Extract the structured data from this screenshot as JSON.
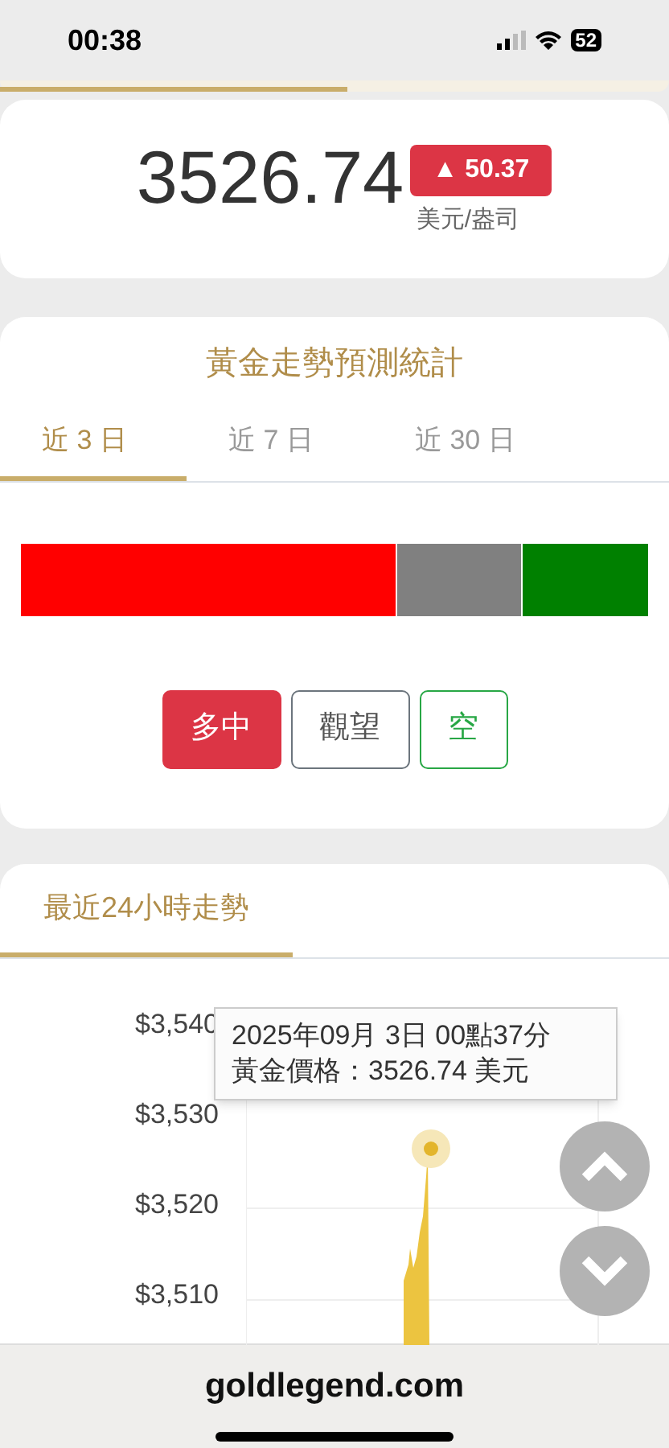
{
  "status_bar": {
    "time": "00:38",
    "battery": "52"
  },
  "top_progress": {
    "level": 0.52
  },
  "price": {
    "value": "3526.74",
    "change": "▲ 50.37",
    "unit": "美元/盎司"
  },
  "forecast": {
    "title": "黃金走勢預測統計",
    "tabs": [
      {
        "label": "近 3 日",
        "selected": true
      },
      {
        "label": "近 7 日",
        "selected": false
      },
      {
        "label": "近 30 日",
        "selected": false
      }
    ],
    "segments": [
      {
        "color": "#ff0000"
      },
      {
        "color": "#808080"
      },
      {
        "color": "#008000"
      }
    ],
    "buttons": [
      {
        "label": "多中",
        "kind": "bull",
        "selected": true
      },
      {
        "label": "觀望",
        "kind": "neutral",
        "selected": false
      },
      {
        "label": "空",
        "kind": "bear",
        "selected": false
      }
    ]
  },
  "trend": {
    "tabs": [
      {
        "label": "最近24小時走勢",
        "selected": true
      }
    ],
    "yticks": [
      "$3,540",
      "$3,530",
      "$3,520",
      "$3,510"
    ],
    "tooltip": {
      "line1": "2025年09月 3日 00點37分",
      "line2": "黃金價格：3526.74 美元"
    }
  },
  "footer": {
    "domain": "goldlegend.com"
  }
}
